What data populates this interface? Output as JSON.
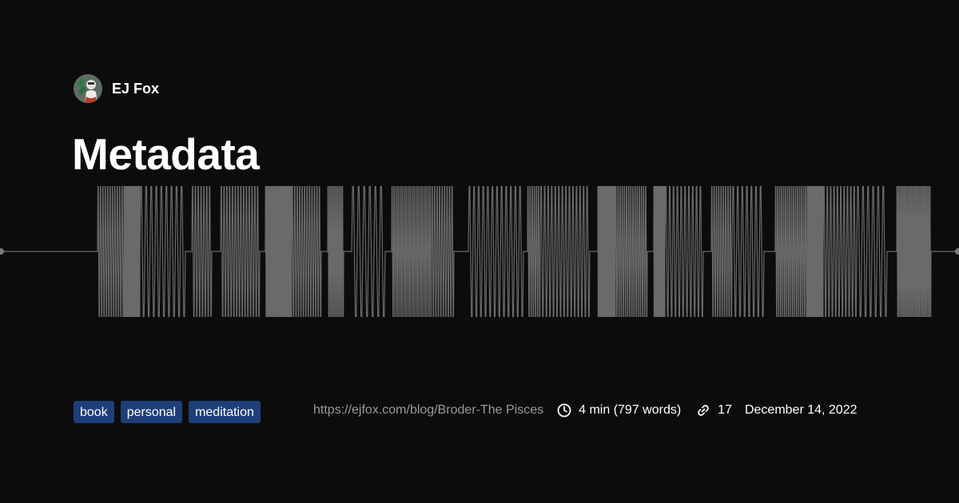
{
  "author": {
    "name": "EJ Fox"
  },
  "post": {
    "title": "Metadata",
    "tags": [
      "book",
      "personal",
      "meditation"
    ],
    "url": "https://ejfox.com/blog/Broder-The Pisces",
    "read_time": "4 min (797 words)",
    "links_count": "17",
    "date": "December 14, 2022"
  },
  "icons": {
    "read_time": "clock-icon",
    "links": "link-icon"
  },
  "colors": {
    "background": "#0c0c0c",
    "waveform": "#6a6a6a",
    "tag_background": "#1e3f7a",
    "url_text": "#9a9a9a"
  }
}
